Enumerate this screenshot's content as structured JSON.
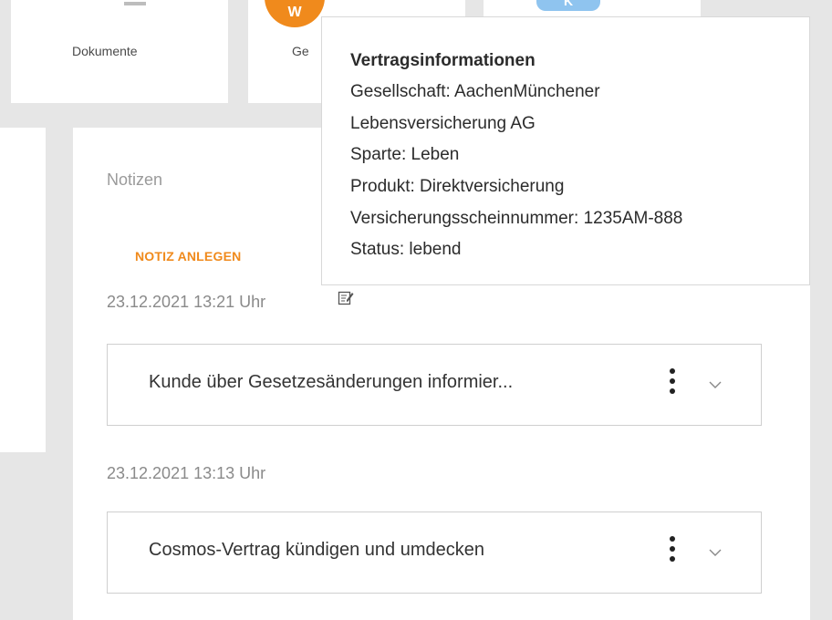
{
  "tiles": {
    "documents_label": "Dokumente",
    "ges_label_partial": "Ge",
    "orange_badge_text": "W",
    "blue_badge_text": "K"
  },
  "notes": {
    "title": "Notizen",
    "add_note_label": "NOTIZ ANLEGEN",
    "entries": [
      {
        "date": "23.12.2021 13:21 Uhr",
        "text": "Kunde über Gesetzesänderungen informier..."
      },
      {
        "date": "23.12.2021 13:13 Uhr",
        "text": "Cosmos-Vertrag kündigen und umdecken"
      }
    ]
  },
  "tooltip": {
    "title": "Vertragsinformationen",
    "lines": [
      "Gesellschaft: AachenMünchener",
      "Lebensversicherung AG",
      "Sparte: Leben",
      "Produkt: Direktversicherung",
      "Versicherungsscheinnummer: 1235AM-888",
      "Status: lebend"
    ]
  },
  "colors": {
    "accent_orange": "#f08a1c",
    "accent_blue": "#8fc4ef",
    "background": "#e6e6e6"
  },
  "icons": [
    "documents-icon",
    "edit-note-icon",
    "kebab-menu-icon",
    "chevron-down-icon"
  ]
}
